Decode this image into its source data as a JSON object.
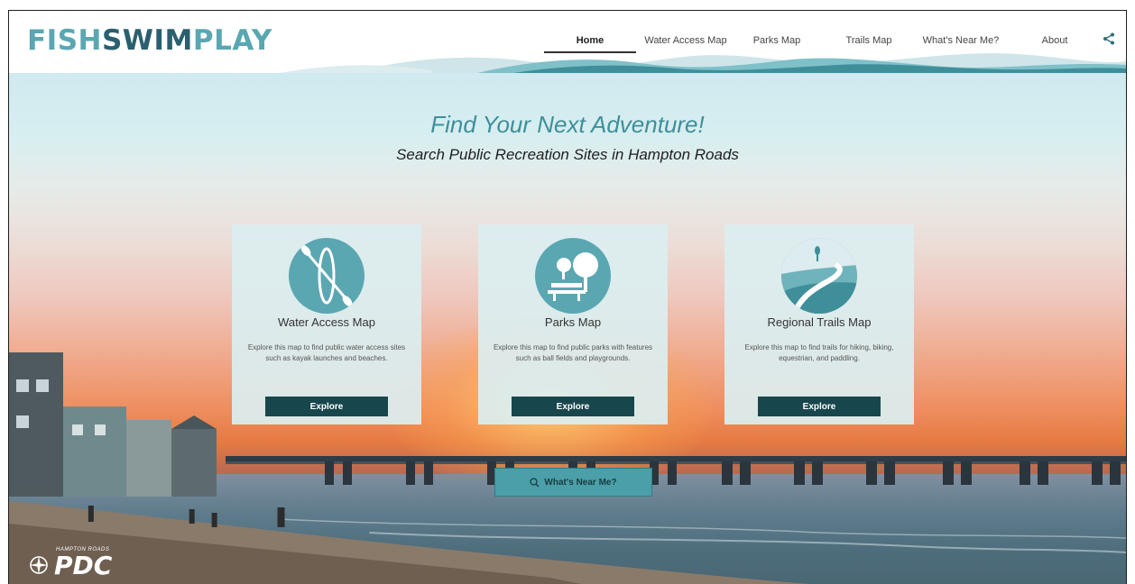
{
  "header": {
    "logo_left": "FISH",
    "logo_mid": "SWIM",
    "logo_right": "PLAY",
    "nav": [
      {
        "label": "Home",
        "active": true
      },
      {
        "label": "Water Access Map"
      },
      {
        "label": "Parks Map"
      },
      {
        "label": "Trails Map"
      },
      {
        "label": "What's Near Me?"
      },
      {
        "label": "About"
      }
    ],
    "share_icon": "share-icon"
  },
  "hero": {
    "title": "Find Your Next Adventure!",
    "subtitle": "Search Public Recreation Sites in Hampton Roads"
  },
  "cards": [
    {
      "title": "Water Access Map",
      "description": "Explore this map to find public water access sites such as kayak launches and beaches.",
      "button": "Explore",
      "icon": "kayak-icon"
    },
    {
      "title": "Parks Map",
      "description": "Explore this map to find public parks with features such as ball fields and playgrounds.",
      "button": "Explore",
      "icon": "park-icon"
    },
    {
      "title": "Regional Trails Map",
      "description": "Explore this map to find trails for hiking, biking, equestrian, and paddling.",
      "button": "Explore",
      "icon": "trail-icon"
    }
  ],
  "near_button": "What's Near Me?",
  "footer_logo": {
    "small": "HAMPTON ROADS",
    "big": "PDC"
  },
  "colors": {
    "accent": "#5aa7b2",
    "dark": "#18464d",
    "title": "#3f8f9a"
  }
}
